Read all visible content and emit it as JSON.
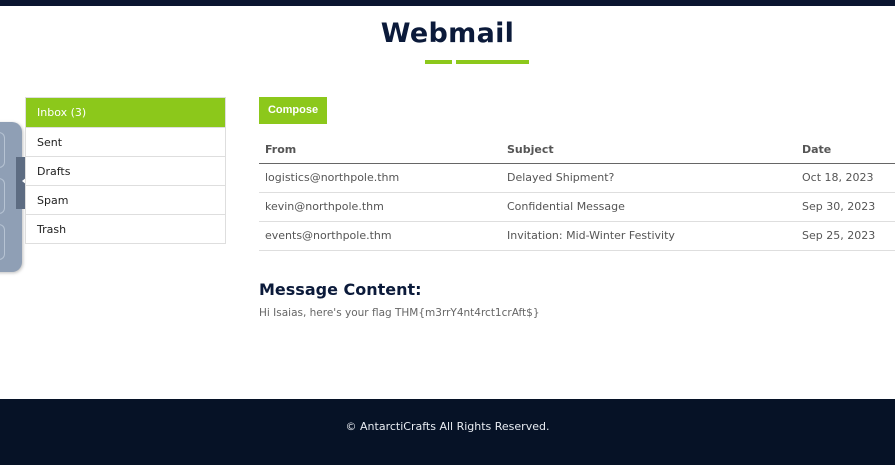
{
  "header": {
    "title": "Webmail"
  },
  "colors": {
    "accent": "#8cc81b",
    "navy": "#0b1a3a",
    "footer_bg": "#061226",
    "side_panel": "#8f9fb5"
  },
  "sidebar": {
    "folders": [
      {
        "label": "Inbox (3)",
        "active": true
      },
      {
        "label": "Sent",
        "active": false
      },
      {
        "label": "Drafts",
        "active": false
      },
      {
        "label": "Spam",
        "active": false
      },
      {
        "label": "Trash",
        "active": false
      }
    ]
  },
  "toolbar": {
    "compose_label": "Compose"
  },
  "mail_table": {
    "headers": {
      "from": "From",
      "subject": "Subject",
      "date": "Date"
    },
    "rows": [
      {
        "from": "logistics@northpole.thm",
        "subject": "Delayed Shipment?",
        "date": "Oct 18, 2023"
      },
      {
        "from": "kevin@northpole.thm",
        "subject": "Confidential Message",
        "date": "Sep 30, 2023"
      },
      {
        "from": "events@northpole.thm",
        "subject": "Invitation: Mid-Winter Festivity",
        "date": "Sep 25, 2023"
      }
    ]
  },
  "message": {
    "heading": "Message Content:",
    "body": "Hi Isaias, here's your flag THM{m3rrY4nt4rct1crAft$}"
  },
  "footer": {
    "text": "© AntarctiCrafts All Rights Reserved."
  },
  "icons": {
    "side_handle": "chevron-left-icon"
  }
}
